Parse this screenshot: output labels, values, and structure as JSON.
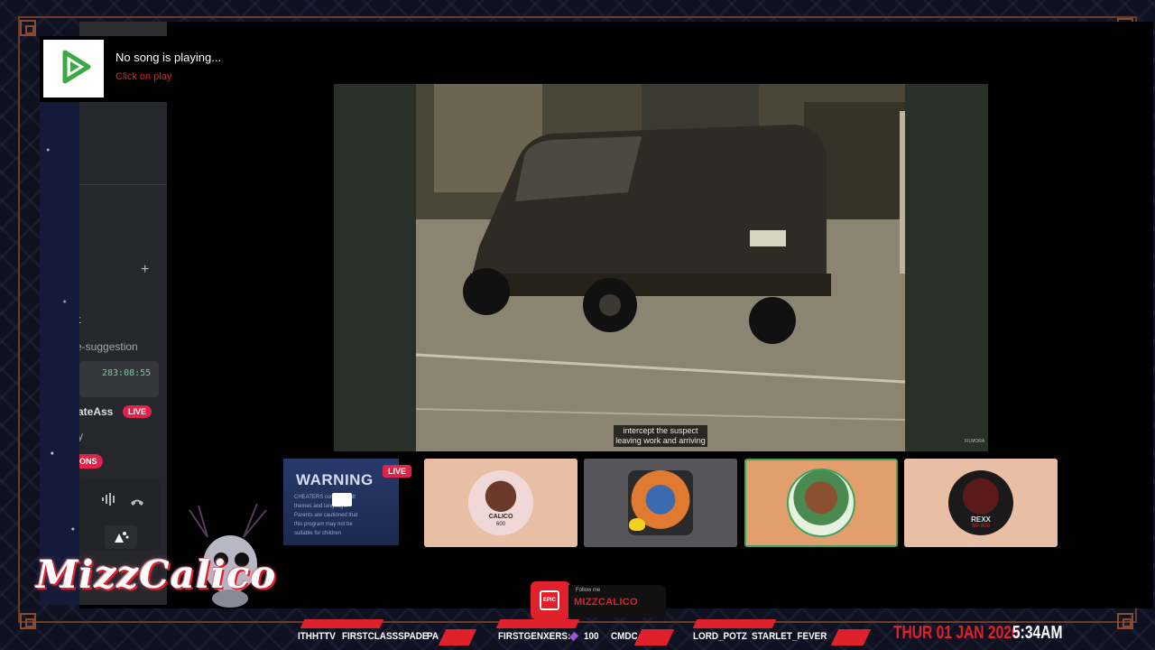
{
  "music_widget": {
    "title": "No song is playing...",
    "subtitle": "Click on play"
  },
  "discord_panel": {
    "channel_fragment": "t",
    "suggestion_fragment": "e-suggestion",
    "timer": "283:08:55",
    "live_user_fragment": "ateAss",
    "live_label": "LIVE",
    "misc_fragment": "y",
    "notifications_fragment": "ONS",
    "add_symbol": "+"
  },
  "video": {
    "subtitle_line1": "intercept the suspect",
    "subtitle_line2": "leaving work and arriving",
    "watermark": "FILMORA"
  },
  "warning_tile": {
    "title": "WARNING",
    "live_label": "LIVE",
    "line1": "CHEATERS    contain adult",
    "line2": "themes and    language.",
    "line3": "Parents are cautioned that",
    "line4": "this program may not be",
    "line5": "suitable for children"
  },
  "participants": [
    {
      "name_fragment": "CALICO",
      "sub": "600"
    },
    {
      "name_fragment": "",
      "sub": ""
    },
    {
      "name_fragment": "",
      "sub": ""
    },
    {
      "name_fragment": "REXX",
      "sub": "BP 800"
    }
  ],
  "branding": {
    "logo_text": "MizzCalico",
    "follow_small": "Follow me",
    "follow_name": "MIZZCALICO",
    "epic_label": "EPIC"
  },
  "ticker": {
    "items": [
      "ITHHTTV",
      "FIRSTCLASSSPADE",
      "PA",
      "FIRSTGENXERS:",
      "100",
      "CMDC",
      "LORD_POTZ",
      "STARLET_FEVER"
    ]
  },
  "clock": {
    "day": "THUR 01 JAN 2026",
    "time": "5:34AM"
  },
  "colors": {
    "accent_red": "#e0202a",
    "live_badge": "#e0234a",
    "active_tile": "#e39e6e",
    "tile_peach": "#e8bfa4",
    "tile_gray": "#55555a",
    "timer_green": "#6fcf97"
  },
  "icons": {
    "music": "play-triangle-icon",
    "audio": "audio-waveform-icon",
    "hangup": "phone-hangup-icon",
    "soundboard": "soundboard-icon"
  }
}
